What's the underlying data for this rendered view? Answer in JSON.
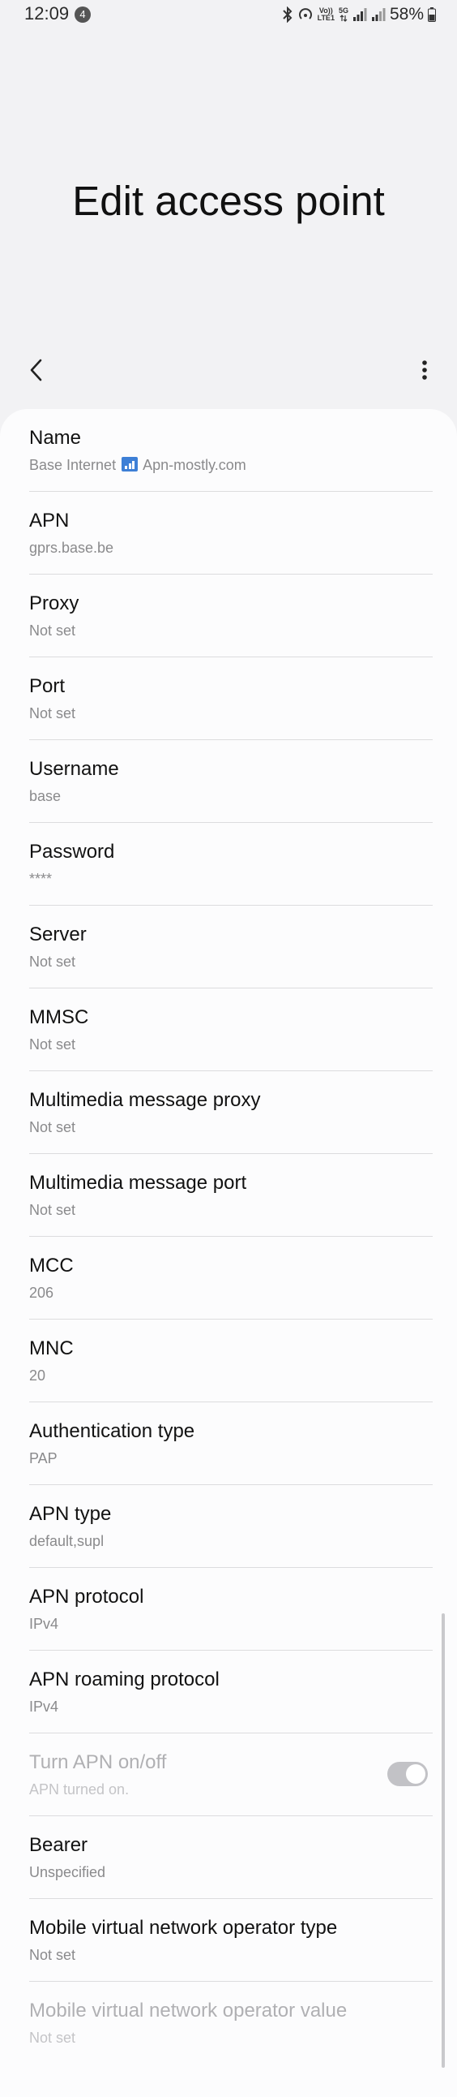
{
  "status_bar": {
    "time": "12:09",
    "notification_count": "4",
    "volte_label": "Vo))",
    "lte_label": "LTE1",
    "fiveg_label": "5G",
    "battery_percent": "58%"
  },
  "header": {
    "title": "Edit access point"
  },
  "fields": [
    {
      "title": "Name",
      "value": "Base Internet",
      "value_suffix": "Apn-mostly.com"
    },
    {
      "title": "APN",
      "value": "gprs.base.be"
    },
    {
      "title": "Proxy",
      "value": "Not set"
    },
    {
      "title": "Port",
      "value": "Not set"
    },
    {
      "title": "Username",
      "value": "base"
    },
    {
      "title": "Password",
      "value": "****"
    },
    {
      "title": "Server",
      "value": "Not set"
    },
    {
      "title": "MMSC",
      "value": "Not set"
    },
    {
      "title": "Multimedia message proxy",
      "value": "Not set"
    },
    {
      "title": "Multimedia message port",
      "value": "Not set"
    },
    {
      "title": "MCC",
      "value": "206"
    },
    {
      "title": "MNC",
      "value": "20"
    },
    {
      "title": "Authentication type",
      "value": "PAP"
    },
    {
      "title": "APN type",
      "value": "default,supl"
    },
    {
      "title": "APN protocol",
      "value": "IPv4"
    },
    {
      "title": "APN roaming protocol",
      "value": "IPv4"
    },
    {
      "title": "Turn APN on/off",
      "value": "APN turned on.",
      "toggle_on": true,
      "disabled": true
    },
    {
      "title": "Bearer",
      "value": "Unspecified"
    },
    {
      "title": "Mobile virtual network operator type",
      "value": "Not set"
    },
    {
      "title": "Mobile virtual network operator value",
      "value": "Not set",
      "disabled": true
    }
  ],
  "colors": {
    "background": "#f2f2f4",
    "card": "#fcfcfd",
    "secondary_text": "#8a8a8c",
    "name_icon": "#3d7fd6"
  },
  "icons": {
    "back": "back-arrow-icon",
    "more": "more-vertical-icon"
  }
}
